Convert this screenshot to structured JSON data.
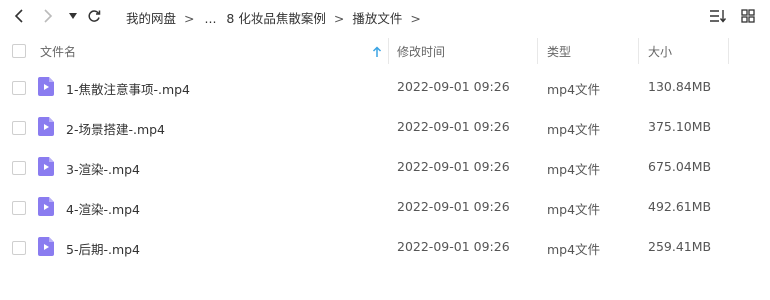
{
  "nav": {
    "back_icon": "chevron-left-icon",
    "forward_icon": "chevron-right-icon",
    "history_icon": "dropdown-triangle-icon",
    "refresh_icon": "refresh-icon"
  },
  "breadcrumb": {
    "root": "我的网盘",
    "sep": ">",
    "ellipsis": "...",
    "folder1": "8 化妆品焦散案例",
    "folder2": "播放文件"
  },
  "view_controls": {
    "sort_icon": "sort-list-icon",
    "grid_icon": "grid-view-icon"
  },
  "columns": {
    "name": "文件名",
    "modified": "修改时间",
    "type": "类型",
    "size": "大小"
  },
  "colors": {
    "file_icon": "#8a7cf0",
    "sort_arrow": "#3aa3e3"
  },
  "files": [
    {
      "name": "1-焦散注意事项-.mp4",
      "modified": "2022-09-01 09:26",
      "type": "mp4文件",
      "size": "130.84MB"
    },
    {
      "name": "2-场景搭建-.mp4",
      "modified": "2022-09-01 09:26",
      "type": "mp4文件",
      "size": "375.10MB"
    },
    {
      "name": "3-渲染-.mp4",
      "modified": "2022-09-01 09:26",
      "type": "mp4文件",
      "size": "675.04MB"
    },
    {
      "name": "4-渲染-.mp4",
      "modified": "2022-09-01 09:26",
      "type": "mp4文件",
      "size": "492.61MB"
    },
    {
      "name": "5-后期-.mp4",
      "modified": "2022-09-01 09:26",
      "type": "mp4文件",
      "size": "259.41MB"
    }
  ]
}
